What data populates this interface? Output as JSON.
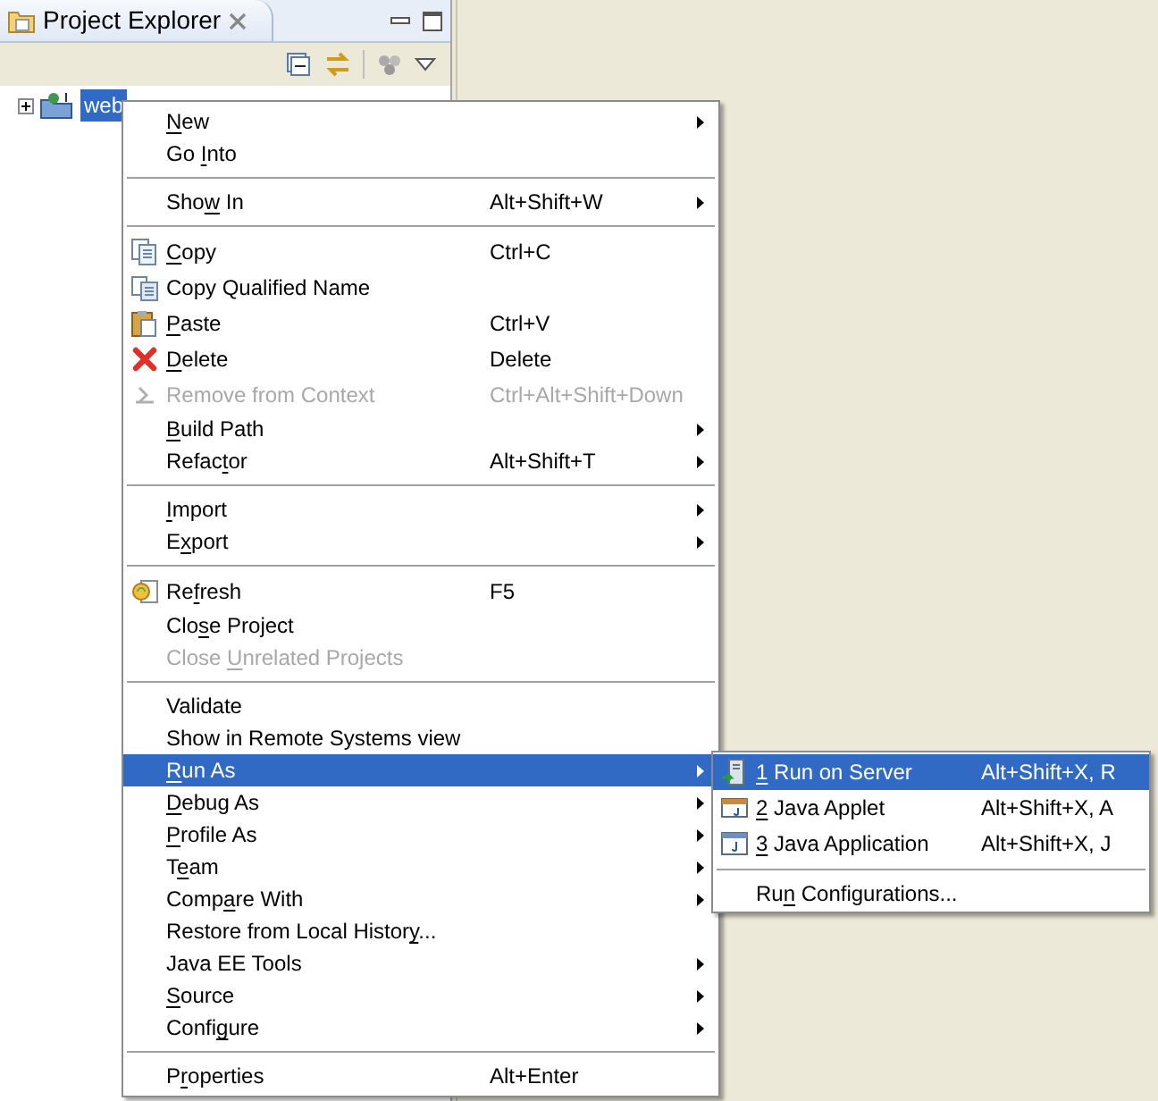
{
  "view": {
    "title": "Project Explorer"
  },
  "tree": [
    {
      "label": "web",
      "selected": true,
      "expanded": false
    }
  ],
  "context_menu": [
    {
      "kind": "item",
      "label": {
        "key": "N",
        "after": "ew"
      },
      "submenu": true
    },
    {
      "kind": "item",
      "label": {
        "before": "Go ",
        "key": "I",
        "after": "nto"
      }
    },
    {
      "kind": "separator"
    },
    {
      "kind": "item",
      "label": {
        "before": "Sho",
        "key": "w",
        "after": " In"
      },
      "shortcut": "Alt+Shift+W",
      "submenu": true
    },
    {
      "kind": "separator"
    },
    {
      "kind": "copy",
      "label": {
        "key": "C",
        "after": "opy"
      },
      "shortcut": "Ctrl+C"
    },
    {
      "kind": "copyname",
      "label": {
        "before": "Copy Qualified Name"
      }
    },
    {
      "kind": "paste",
      "label": {
        "key": "P",
        "after": "aste"
      },
      "shortcut": "Ctrl+V"
    },
    {
      "kind": "delete",
      "label": {
        "key": "D",
        "after": "elete"
      },
      "shortcut": "Delete"
    },
    {
      "kind": "remove",
      "label": {
        "before": "Remove from Context"
      },
      "shortcut": "Ctrl+Alt+Shift+Down",
      "disabled": true
    },
    {
      "kind": "item",
      "label": {
        "key": "B",
        "after": "uild Path"
      },
      "submenu": true
    },
    {
      "kind": "item",
      "label": {
        "before": "Refac",
        "key": "t",
        "after": "or"
      },
      "shortcut": "Alt+Shift+T",
      "submenu": true
    },
    {
      "kind": "separator"
    },
    {
      "kind": "item",
      "label": {
        "key": "I",
        "after": "mport"
      },
      "submenu": true
    },
    {
      "kind": "item",
      "label": {
        "before": "E",
        "key": "x",
        "after": "port"
      },
      "submenu": true
    },
    {
      "kind": "separator"
    },
    {
      "kind": "refresh",
      "label": {
        "before": "Re",
        "key": "f",
        "after": "resh"
      },
      "shortcut": "F5"
    },
    {
      "kind": "item",
      "label": {
        "before": "Clo",
        "key": "s",
        "after": "e Project"
      }
    },
    {
      "kind": "item",
      "label": {
        "before": "Close ",
        "key": "U",
        "after": "nrelated Projects"
      },
      "disabled": true
    },
    {
      "kind": "separator"
    },
    {
      "kind": "item",
      "label": {
        "before": "Validate"
      }
    },
    {
      "kind": "item",
      "label": {
        "before": "Show in Remote Systems view"
      }
    },
    {
      "kind": "item",
      "label": {
        "key": "R",
        "after": "un As"
      },
      "submenu": true,
      "selected": true
    },
    {
      "kind": "item",
      "label": {
        "key": "D",
        "after": "ebug As"
      },
      "submenu": true
    },
    {
      "kind": "item",
      "label": {
        "key": "P",
        "after": "rofile As"
      },
      "submenu": true
    },
    {
      "kind": "item",
      "label": {
        "before": "T",
        "key": "e",
        "after": "am"
      },
      "submenu": true
    },
    {
      "kind": "item",
      "label": {
        "before": "Comp",
        "key": "a",
        "after": "re With"
      },
      "submenu": true
    },
    {
      "kind": "item",
      "label": {
        "before": "Restore from Local Histor",
        "key": "y",
        "after": "..."
      }
    },
    {
      "kind": "item",
      "label": {
        "before": "Java EE Tools"
      },
      "submenu": true
    },
    {
      "kind": "item",
      "label": {
        "key": "S",
        "after": "ource"
      },
      "submenu": true
    },
    {
      "kind": "item",
      "label": {
        "before": "Confi",
        "key": "g",
        "after": "ure"
      },
      "submenu": true
    },
    {
      "kind": "separator"
    },
    {
      "kind": "item",
      "label": {
        "before": "P",
        "key": "r",
        "after": "operties"
      },
      "shortcut": "Alt+Enter"
    }
  ],
  "submenu": [
    {
      "kind": "server",
      "label": {
        "key": "1",
        "after": " Run on Server"
      },
      "shortcut": "Alt+Shift+X, R",
      "selected": true
    },
    {
      "kind": "applet",
      "label": {
        "key": "2",
        "after": " Java Applet"
      },
      "shortcut": "Alt+Shift+X, A",
      "selected": false
    },
    {
      "kind": "application",
      "label": {
        "key": "3",
        "after": " Java Application"
      },
      "shortcut": "Alt+Shift+X, J",
      "selected": false
    },
    {
      "kind": "separator"
    },
    {
      "kind": "item",
      "label": {
        "before": "Ru",
        "key": "n",
        "after": " Configurations..."
      },
      "selected": false
    }
  ]
}
